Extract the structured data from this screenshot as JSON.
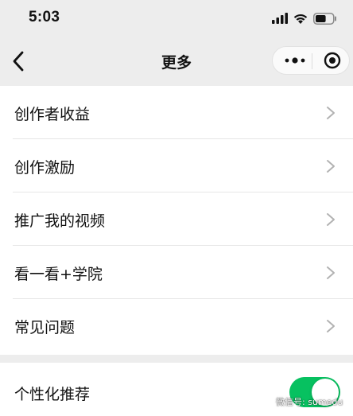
{
  "status_bar": {
    "time": "5:03",
    "icons": [
      "signal-icon",
      "wifi-icon",
      "battery-icon"
    ],
    "battery_level": 0.6
  },
  "nav": {
    "title": "更多",
    "back_icon": "chevron-left-icon",
    "capsule_icons": [
      "more-dots-icon",
      "close-circle-icon"
    ]
  },
  "menu": {
    "items": [
      {
        "label": "创作者收益"
      },
      {
        "label": "创作激励"
      },
      {
        "label": "推广我的视频"
      },
      {
        "label": "看一看+学院"
      },
      {
        "label": "常见问题"
      }
    ]
  },
  "settings": {
    "personalized_label": "个性化推荐",
    "personalized_on": true
  },
  "watermark": {
    "text": "微信号: sumedu"
  },
  "colors": {
    "background": "#ededed",
    "accent_green": "#07c160",
    "chevron": "#b2b2b2"
  }
}
